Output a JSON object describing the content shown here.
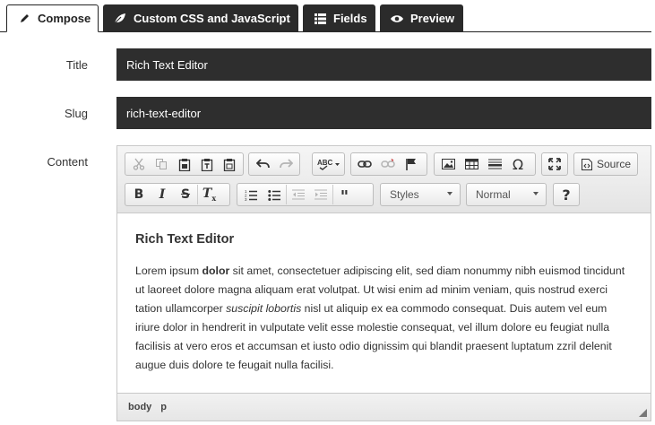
{
  "tabs": [
    {
      "label": "Compose",
      "icon": "pencil-icon",
      "active": true
    },
    {
      "label": "Custom CSS and JavaScript",
      "icon": "leaf-icon",
      "active": false
    },
    {
      "label": "Fields",
      "icon": "list-icon",
      "active": false
    },
    {
      "label": "Preview",
      "icon": "eye-icon",
      "active": false
    }
  ],
  "form": {
    "title_label": "Title",
    "title_value": "Rich Text Editor",
    "slug_label": "Slug",
    "slug_value": "rich-text-editor",
    "content_label": "Content"
  },
  "toolbar": {
    "source_label": "Source",
    "styles_label": "Styles",
    "format_label": "Normal",
    "help_label": "?"
  },
  "content": {
    "heading": "Rich Text Editor",
    "p_part1": "Lorem ipsum ",
    "p_bold": "dolor",
    "p_part2": " sit amet, consectetuer adipiscing elit, sed diam nonummy nibh euismod tincidunt ut laoreet dolore magna aliquam erat volutpat. Ut wisi enim ad minim veniam, quis nostrud exerci tation ullamcorper ",
    "p_italic": "suscipit lobortis",
    "p_part3": " nisl ut aliquip ex ea commodo consequat. Duis autem vel eum iriure dolor in hendrerit in vulputate velit esse molestie consequat, vel illum dolore eu feugiat nulla facilisis at vero eros et accumsan et iusto odio dignissim qui blandit praesent luptatum zzril delenit augue duis dolore te feugait nulla facilisi."
  },
  "statusbar": {
    "path1": "body",
    "path2": "p"
  },
  "colors": {
    "tab_bg": "#2b2b2b",
    "field_bg": "#2e2e2e"
  }
}
